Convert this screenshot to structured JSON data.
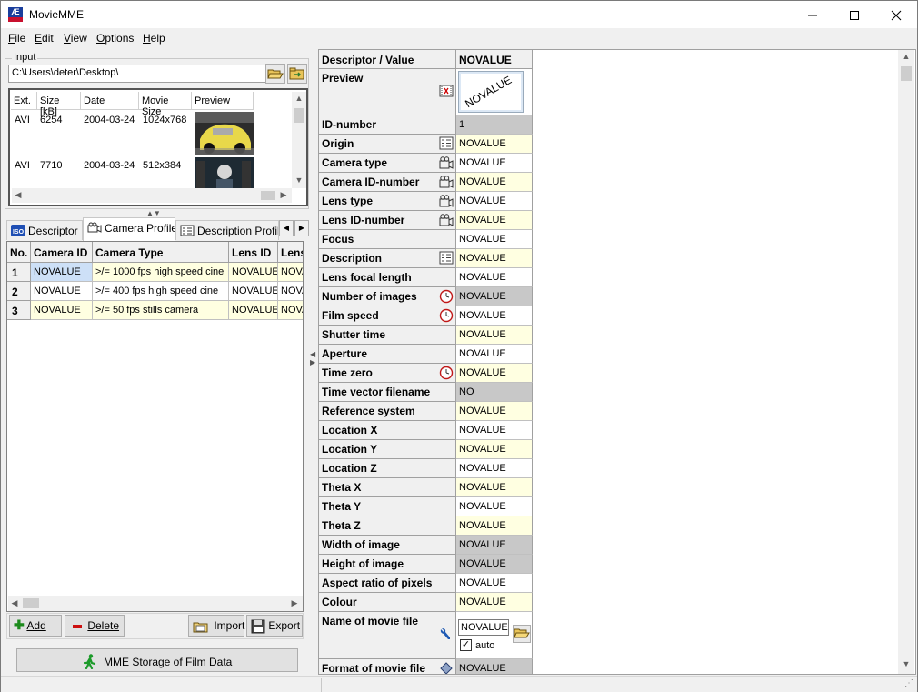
{
  "window": {
    "title": "MovieMME",
    "icon": "app-logo-icon"
  },
  "menu": [
    {
      "label": "File",
      "key": "F"
    },
    {
      "label": "Edit",
      "key": "E"
    },
    {
      "label": "View",
      "key": "V"
    },
    {
      "label": "Options",
      "key": "O"
    },
    {
      "label": "Help",
      "key": "H"
    }
  ],
  "input": {
    "legend": "Input",
    "path": "C:\\Users\\deter\\Desktop\\"
  },
  "file_list": {
    "columns": [
      "Ext.",
      "Size [kB]",
      "Date",
      "Movie Size",
      "Preview"
    ],
    "rows": [
      {
        "ext": "AVI",
        "size": "6254",
        "date": "2004-03-24",
        "movie_size": "1024x768",
        "preview": "car-interior-thumbnail"
      },
      {
        "ext": "AVI",
        "size": "7710",
        "date": "2004-03-24",
        "movie_size": "512x384",
        "preview": "dummy-thumbnail"
      }
    ]
  },
  "tabs": [
    {
      "label": "Descriptor",
      "icon": "iso-icon",
      "active": false
    },
    {
      "label": "Camera Profile",
      "icon": "camera-icon",
      "active": true
    },
    {
      "label": "Description Profile",
      "icon": "list-icon",
      "active": false
    }
  ],
  "camera_table": {
    "columns": [
      "No.",
      "Camera ID",
      "Camera Type",
      "Lens ID",
      "Lens"
    ],
    "rows": [
      {
        "no": "1",
        "camera_id": "NOVALUE",
        "camera_type": ">/= 1000 fps high speed cine",
        "lens_id": "NOVALUE",
        "lens": "NOVA"
      },
      {
        "no": "2",
        "camera_id": "NOVALUE",
        "camera_type": ">/= 400 fps high speed cine",
        "lens_id": "NOVALUE",
        "lens": "NOVA"
      },
      {
        "no": "3",
        "camera_id": "NOVALUE",
        "camera_type": ">/= 50 fps stills camera",
        "lens_id": "NOVALUE",
        "lens": "NOVA"
      }
    ]
  },
  "buttons": {
    "add": "Add",
    "delete": "Delete",
    "import": "Import",
    "export": "Export",
    "mme_storage": "MME Storage of Film Data"
  },
  "descriptor_grid": {
    "header_name": "Descriptor / Value",
    "header_value": "NOVALUE",
    "preview_label": "Preview",
    "preview_stamp": "NOVALUE",
    "rows": [
      {
        "name": "ID-number",
        "value": "1",
        "bg": "gray",
        "icon": ""
      },
      {
        "name": "Origin",
        "value": "NOVALUE",
        "bg": "yellow",
        "icon": "list-icon"
      },
      {
        "name": "Camera type",
        "value": "NOVALUE",
        "bg": "white",
        "icon": "camera-icon"
      },
      {
        "name": "Camera ID-number",
        "value": "NOVALUE",
        "bg": "yellow",
        "icon": "camera-icon"
      },
      {
        "name": "Lens type",
        "value": "NOVALUE",
        "bg": "white",
        "icon": "camera-icon"
      },
      {
        "name": "Lens ID-number",
        "value": "NOVALUE",
        "bg": "yellow",
        "icon": "camera-icon"
      },
      {
        "name": "Focus",
        "value": "NOVALUE",
        "bg": "white",
        "icon": ""
      },
      {
        "name": "Description",
        "value": "NOVALUE",
        "bg": "yellow",
        "icon": "list-icon"
      },
      {
        "name": "Lens focal length",
        "value": "NOVALUE",
        "bg": "white",
        "icon": ""
      },
      {
        "name": "Number of images",
        "value": "NOVALUE",
        "bg": "gray",
        "icon": "clock-icon"
      },
      {
        "name": "Film speed",
        "value": "NOVALUE",
        "bg": "white",
        "icon": "clock-icon"
      },
      {
        "name": "Shutter time",
        "value": "NOVALUE",
        "bg": "yellow",
        "icon": ""
      },
      {
        "name": "Aperture",
        "value": "NOVALUE",
        "bg": "white",
        "icon": ""
      },
      {
        "name": "Time zero",
        "value": "NOVALUE",
        "bg": "yellow",
        "icon": "clock-icon"
      },
      {
        "name": "Time vector filename",
        "value": "NO",
        "bg": "gray",
        "icon": ""
      },
      {
        "name": "Reference system",
        "value": "NOVALUE",
        "bg": "yellow",
        "icon": ""
      },
      {
        "name": "Location X",
        "value": "NOVALUE",
        "bg": "white",
        "icon": ""
      },
      {
        "name": "Location Y",
        "value": "NOVALUE",
        "bg": "yellow",
        "icon": ""
      },
      {
        "name": "Location Z",
        "value": "NOVALUE",
        "bg": "white",
        "icon": ""
      },
      {
        "name": "Theta X",
        "value": "NOVALUE",
        "bg": "yellow",
        "icon": ""
      },
      {
        "name": "Theta Y",
        "value": "NOVALUE",
        "bg": "white",
        "icon": ""
      },
      {
        "name": "Theta Z",
        "value": "NOVALUE",
        "bg": "yellow",
        "icon": ""
      },
      {
        "name": "Width of image",
        "value": "NOVALUE",
        "bg": "gray",
        "icon": ""
      },
      {
        "name": "Height of image",
        "value": "NOVALUE",
        "bg": "gray",
        "icon": ""
      },
      {
        "name": "Aspect ratio of pixels",
        "value": "NOVALUE",
        "bg": "white",
        "icon": ""
      },
      {
        "name": "Colour",
        "value": "NOVALUE",
        "bg": "yellow",
        "icon": ""
      }
    ],
    "movie_file": {
      "name": "Name of movie file",
      "value": "NOVALUE",
      "auto_label": "auto",
      "auto_checked": true
    },
    "format_row": {
      "name": "Format of movie file",
      "value": "NOVALUE"
    }
  },
  "colors": {
    "cell_yellow": "#ffffe1",
    "cell_gray": "#c8c8c8",
    "selection": "#cde0f7"
  }
}
